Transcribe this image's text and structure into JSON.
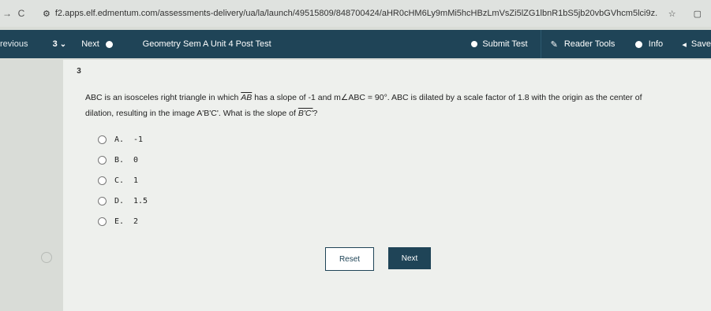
{
  "browser": {
    "back": "→",
    "reload": "C",
    "url": "f2.apps.elf.edmentum.com/assessments-delivery/ua/la/launch/49515809/848700424/aHR0cHM6Ly9mMi5hcHBzLmVsZi5lZG1lbnR1bS5jb20vbGVhcm5lci9z...",
    "star": "☆"
  },
  "toolbar": {
    "previous_label": "revious",
    "question_number": "3",
    "next_label": "Next",
    "title": "Geometry Sem A Unit 4 Post Test",
    "submit_label": "Submit Test",
    "reader_tools_label": "Reader Tools",
    "info_label": "Info",
    "save_label": "Save"
  },
  "question": {
    "badge": "3",
    "text_1": "ABC is an isosceles right triangle in which ",
    "segment_ab": "AB",
    "text_2": " has a slope of -1 and m∠ABC = 90°. ABC is dilated by a scale factor of 1.8 with the origin as the center of dilation, resulting in the image A'B'C'. What is the slope of ",
    "segment_bc": "B'C'",
    "text_3": "?"
  },
  "choices": [
    {
      "letter": "A.",
      "value": "-1"
    },
    {
      "letter": "B.",
      "value": "0"
    },
    {
      "letter": "C.",
      "value": "1"
    },
    {
      "letter": "D.",
      "value": "1.5"
    },
    {
      "letter": "E.",
      "value": "2"
    }
  ],
  "buttons": {
    "reset": "Reset",
    "next": "Next"
  }
}
